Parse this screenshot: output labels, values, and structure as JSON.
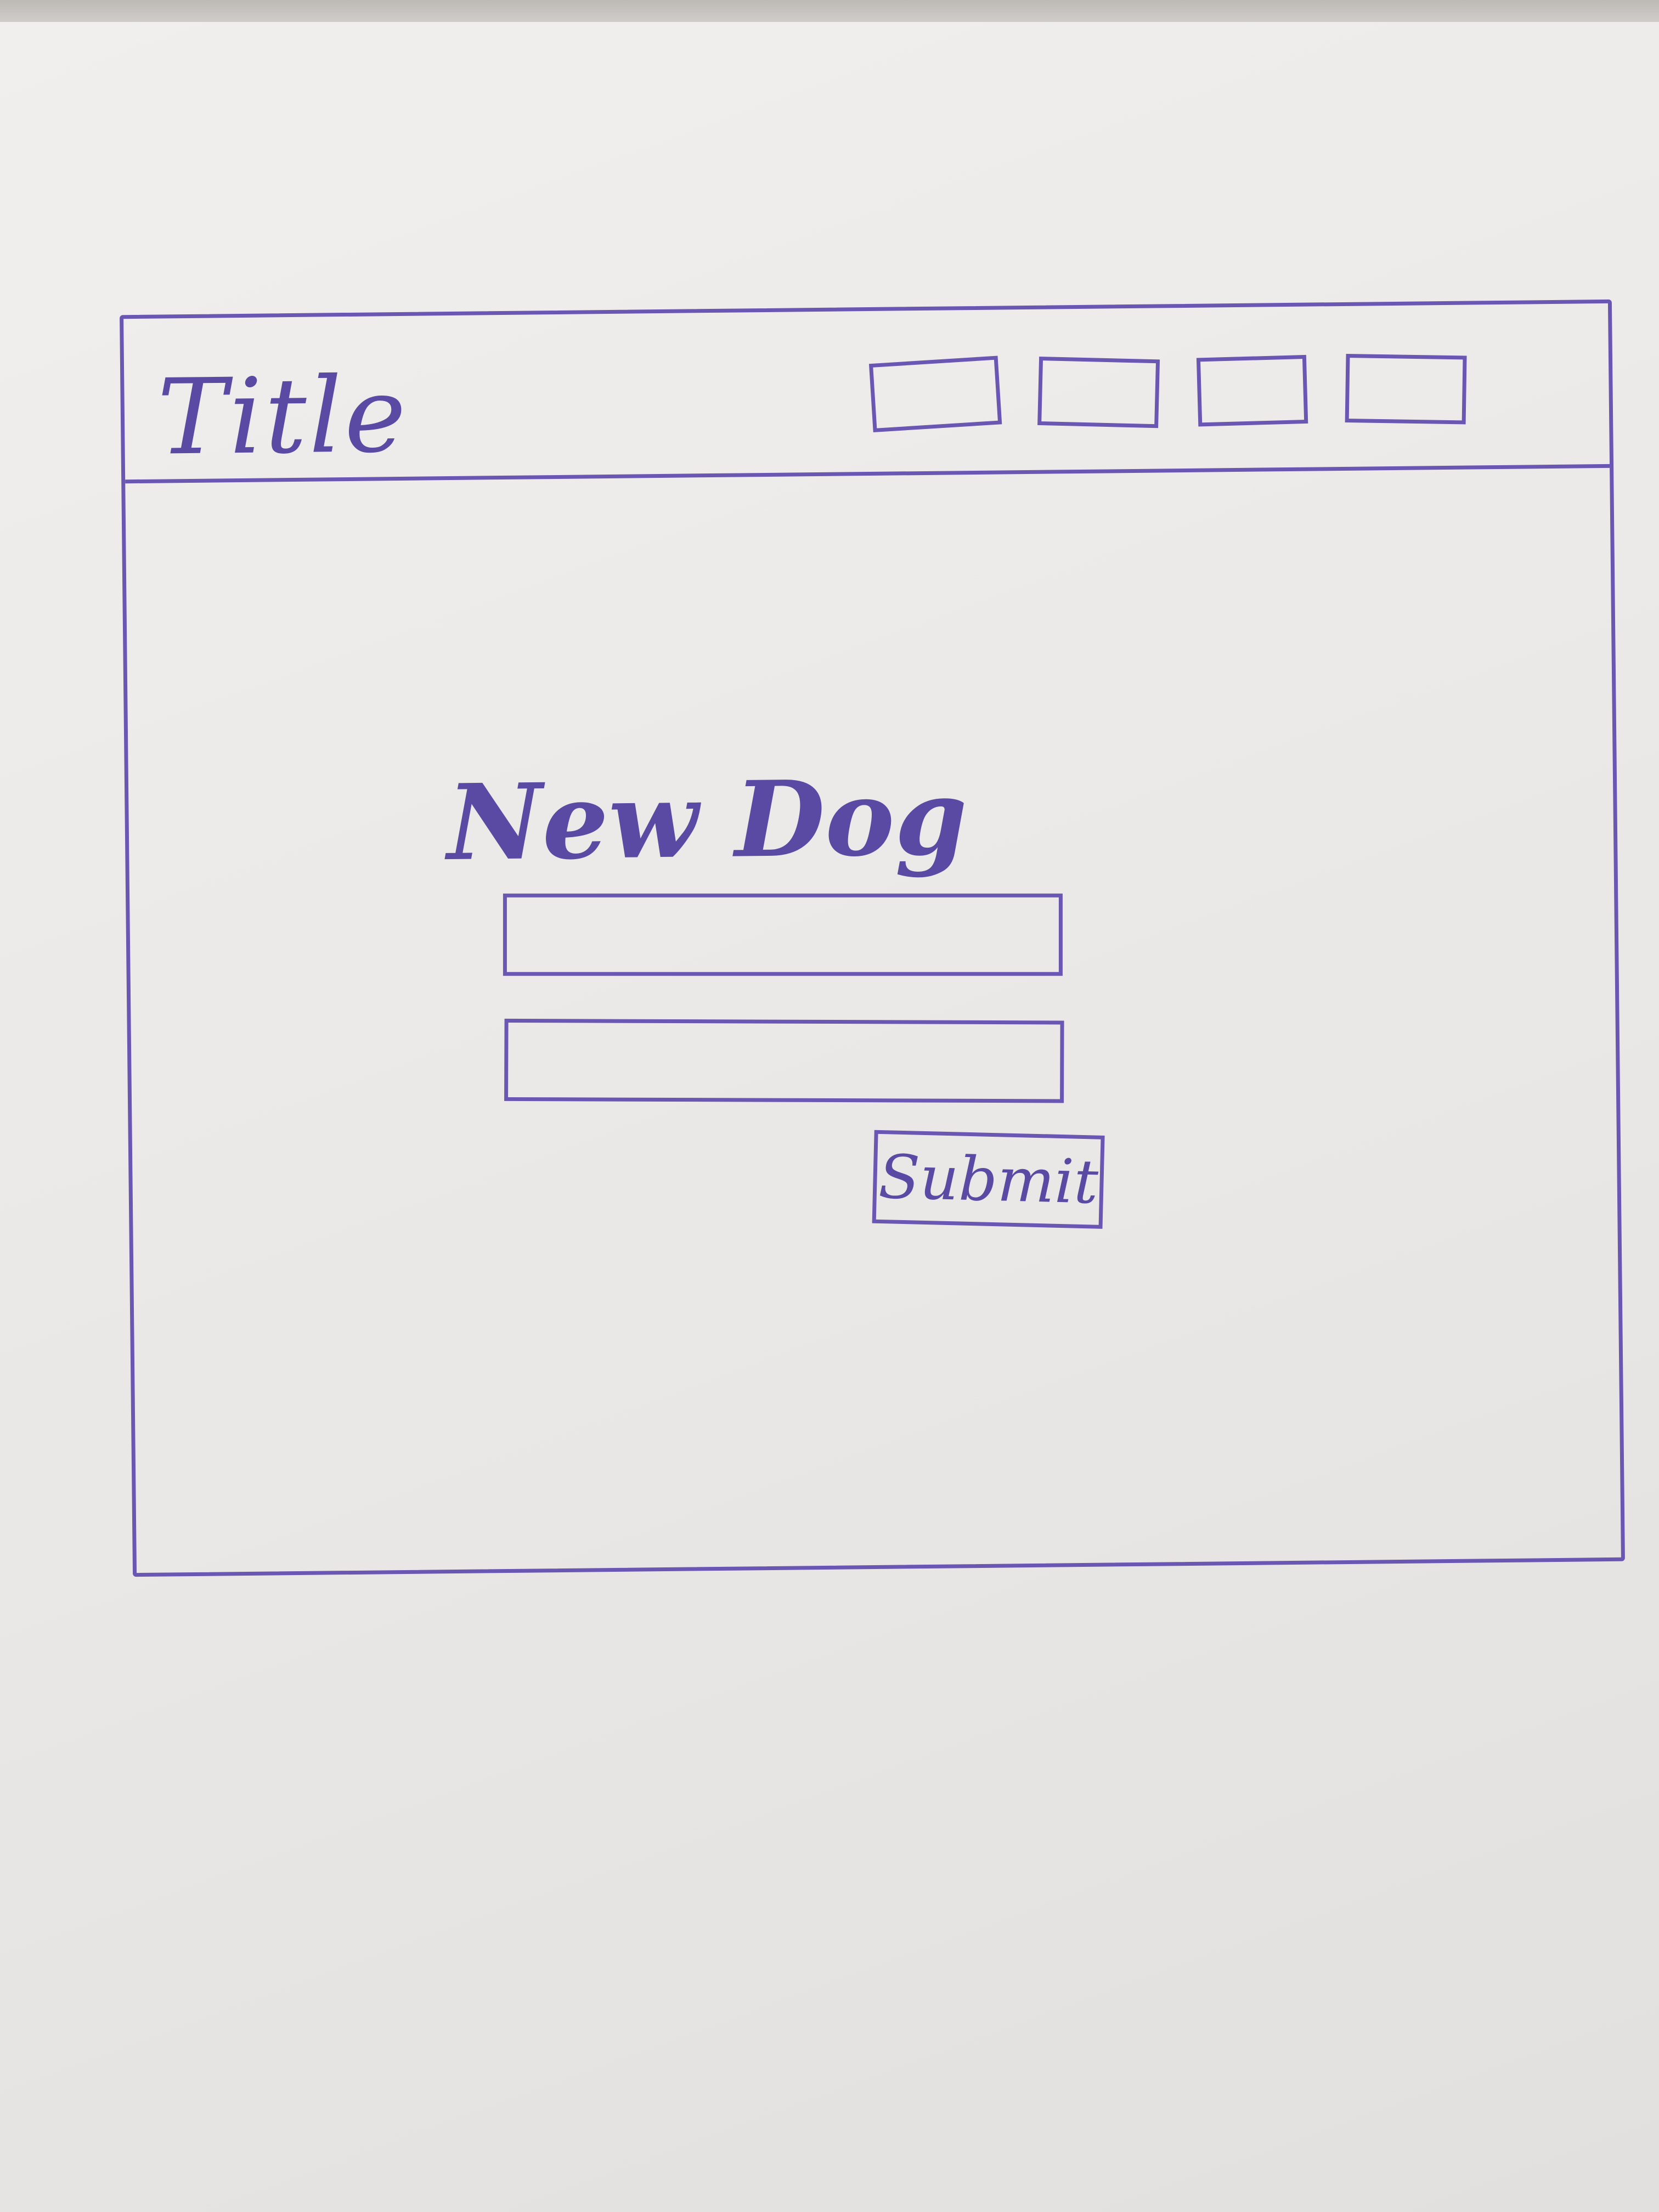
{
  "window": {
    "title": "Title",
    "header_buttons": [
      "",
      "",
      "",
      ""
    ]
  },
  "form": {
    "heading": "New Dog",
    "field_1": {
      "value": "",
      "placeholder": ""
    },
    "field_2": {
      "value": "",
      "placeholder": ""
    },
    "submit_label": "Submit"
  },
  "colors": {
    "ink": "#6a56b3",
    "paper": "#eeecea"
  }
}
